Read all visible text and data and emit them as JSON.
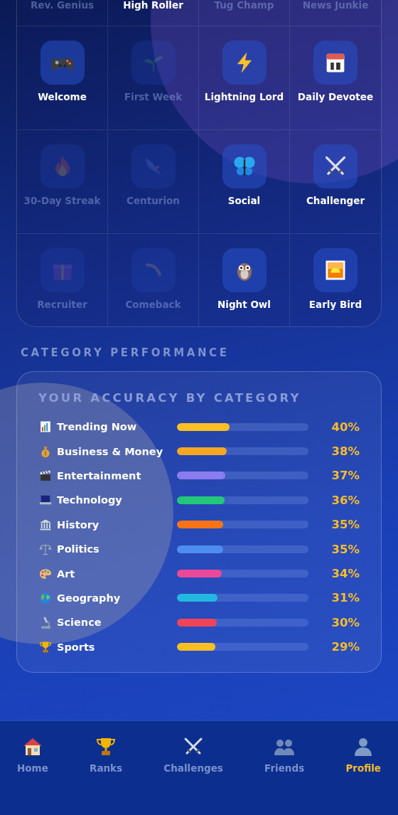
{
  "badges_cut_row": [
    {
      "label": "Rev. Genius",
      "unlocked": false
    },
    {
      "label": "High Roller",
      "unlocked": true
    },
    {
      "label": "Tug Champ",
      "unlocked": false
    },
    {
      "label": "News Junkie",
      "unlocked": false
    }
  ],
  "badges": [
    {
      "label": "Welcome",
      "unlocked": true
    },
    {
      "label": "First Week",
      "unlocked": false
    },
    {
      "label": "Lightning Lord",
      "unlocked": true
    },
    {
      "label": "Daily Devotee",
      "unlocked": true
    },
    {
      "label": "30-Day Streak",
      "unlocked": false
    },
    {
      "label": "Centurion",
      "unlocked": false
    },
    {
      "label": "Social",
      "unlocked": true
    },
    {
      "label": "Challenger",
      "unlocked": true
    },
    {
      "label": "Recruiter",
      "unlocked": false
    },
    {
      "label": "Comeback",
      "unlocked": false
    },
    {
      "label": "Night Owl",
      "unlocked": true
    },
    {
      "label": "Early Bird",
      "unlocked": true
    }
  ],
  "section_heading": "CATEGORY PERFORMANCE",
  "accuracy": {
    "title": "YOUR ACCURACY BY CATEGORY",
    "rows": [
      {
        "name": "Trending Now",
        "level": 0.4,
        "percent": "40%",
        "color": "#fbbf24"
      },
      {
        "name": "Business & Money",
        "level": 0.38,
        "percent": "38%",
        "color": "#f5a623"
      },
      {
        "name": "Entertainment",
        "level": 0.37,
        "percent": "37%",
        "color": "#8b7cf0"
      },
      {
        "name": "Technology",
        "level": 0.36,
        "percent": "36%",
        "color": "#22c77a"
      },
      {
        "name": "History",
        "level": 0.35,
        "percent": "35%",
        "color": "#f97316"
      },
      {
        "name": "Politics",
        "level": 0.35,
        "percent": "35%",
        "color": "#4d8df0"
      },
      {
        "name": "Art",
        "level": 0.34,
        "percent": "34%",
        "color": "#ec4899"
      },
      {
        "name": "Geography",
        "level": 0.31,
        "percent": "31%",
        "color": "#22b8e0"
      },
      {
        "name": "Science",
        "level": 0.3,
        "percent": "30%",
        "color": "#ef4458"
      },
      {
        "name": "Sports",
        "level": 0.29,
        "percent": "29%",
        "color": "#fbbf24"
      }
    ]
  },
  "tab_bar": [
    {
      "label": "Home",
      "selected": false
    },
    {
      "label": "Ranks",
      "selected": false
    },
    {
      "label": "Challenges",
      "selected": false
    },
    {
      "label": "Friends",
      "selected": false
    },
    {
      "label": "Profile",
      "selected": true
    }
  ]
}
